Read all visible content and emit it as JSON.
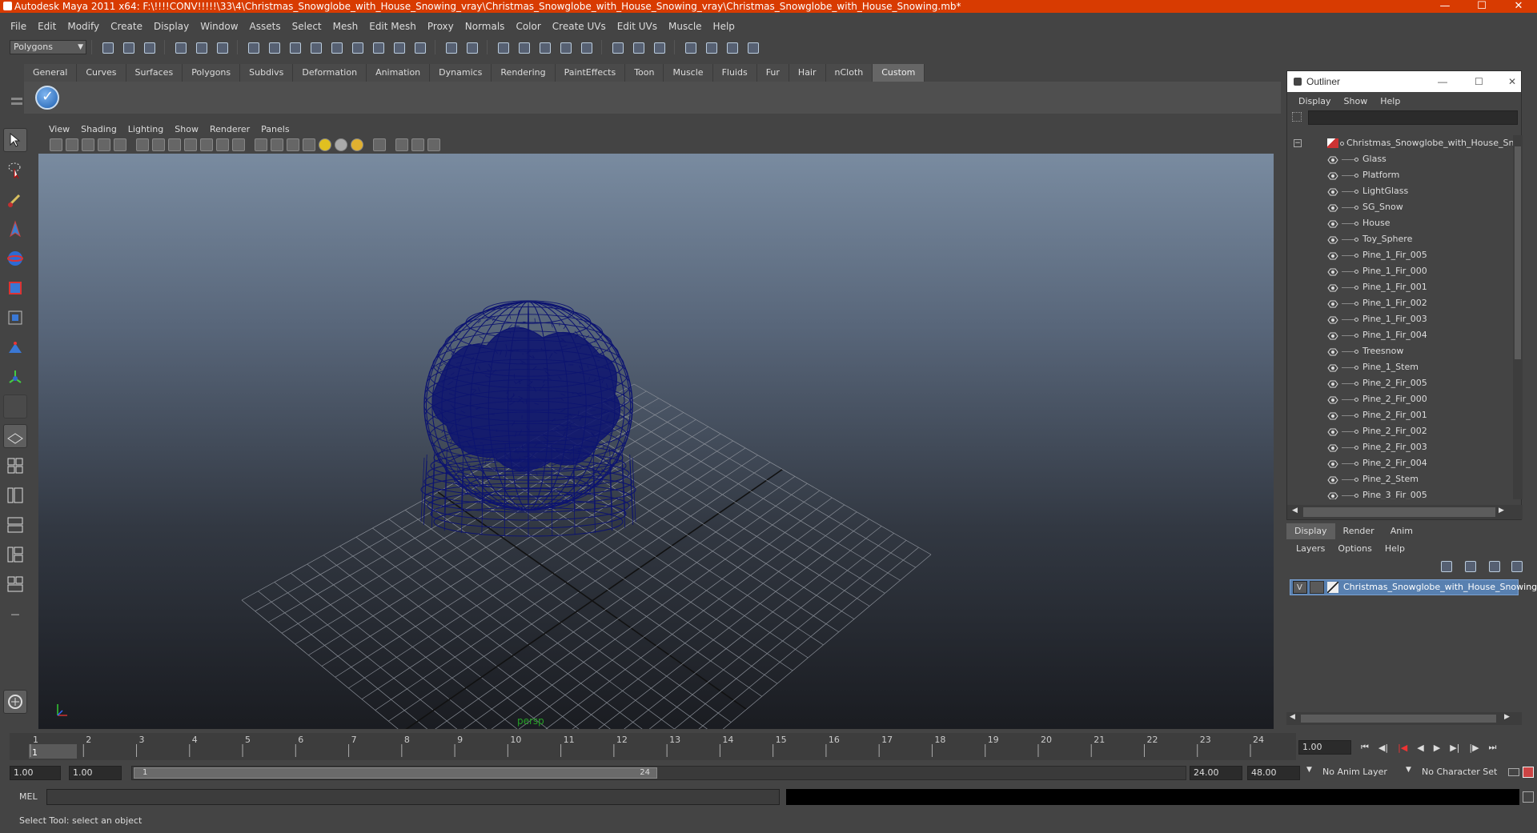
{
  "window": {
    "title": "Autodesk Maya 2011 x64: F:\\!!!!CONV!!!!!\\33\\4\\Christmas_Snowglobe_with_House_Snowing_vray\\Christmas_Snowglobe_with_House_Snowing_vray\\Christmas_Snowglobe_with_House_Snowing.mb*",
    "accent": "#d83b01"
  },
  "menubar": [
    "File",
    "Edit",
    "Modify",
    "Create",
    "Display",
    "Window",
    "Assets",
    "Select",
    "Mesh",
    "Edit Mesh",
    "Proxy",
    "Normals",
    "Color",
    "Create UVs",
    "Edit UVs",
    "Muscle",
    "Help"
  ],
  "statusline": {
    "menuset": "Polygons"
  },
  "shelf": {
    "tabs": [
      "General",
      "Curves",
      "Surfaces",
      "Polygons",
      "Subdivs",
      "Deformation",
      "Animation",
      "Dynamics",
      "Rendering",
      "PaintEffects",
      "Toon",
      "Muscle",
      "Fluids",
      "Fur",
      "Hair",
      "nCloth",
      "Custom"
    ],
    "active": "Custom"
  },
  "viewport": {
    "menu": [
      "View",
      "Shading",
      "Lighting",
      "Show",
      "Renderer",
      "Panels"
    ],
    "camera_label": "persp",
    "wire_color": "#0d1470"
  },
  "outliner": {
    "title": "Outliner",
    "menu": [
      "Display",
      "Show",
      "Help"
    ],
    "root": "Christmas_Snowglobe_with_House_Snowing",
    "items": [
      "Glass",
      "Platform",
      "LightGlass",
      "SG_Snow",
      "House",
      "Toy_Sphere",
      "Pine_1_Fir_005",
      "Pine_1_Fir_000",
      "Pine_1_Fir_001",
      "Pine_1_Fir_002",
      "Pine_1_Fir_003",
      "Pine_1_Fir_004",
      "Treesnow",
      "Pine_1_Stem",
      "Pine_2_Fir_005",
      "Pine_2_Fir_000",
      "Pine_2_Fir_001",
      "Pine_2_Fir_002",
      "Pine_2_Fir_003",
      "Pine_2_Fir_004",
      "Pine_2_Stem",
      "Pine_3_Fir_005"
    ]
  },
  "layers": {
    "tabs": [
      "Display",
      "Render",
      "Anim"
    ],
    "active_tab": "Display",
    "menu": [
      "Layers",
      "Options",
      "Help"
    ],
    "layer": {
      "visible": "V",
      "name": "Christmas_Snowglobe_with_House_Snowing"
    }
  },
  "timeline": {
    "ticks": [
      "1",
      "2",
      "3",
      "4",
      "5",
      "6",
      "7",
      "8",
      "9",
      "10",
      "11",
      "12",
      "13",
      "14",
      "15",
      "16",
      "17",
      "18",
      "19",
      "20",
      "21",
      "22",
      "23",
      "24"
    ],
    "current_frame": "1",
    "current_time_field": "1.00"
  },
  "range": {
    "start_time": "1.00",
    "playback_start": "1.00",
    "slider_start": "1",
    "slider_end": "24",
    "playback_end": "24.00",
    "end_time": "48.00",
    "anim_layer": "No Anim Layer",
    "character_set": "No Character Set"
  },
  "commandline": {
    "label": "MEL"
  },
  "helpline": {
    "text": "Select Tool: select an object"
  }
}
